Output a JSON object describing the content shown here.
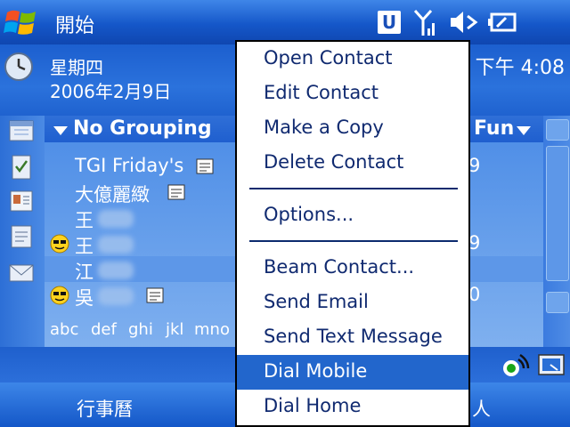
{
  "titlebar": {
    "title": "開始",
    "status_u": "U"
  },
  "today": {
    "day": "星期四",
    "date": "2006年2月9日",
    "time": "下午 4:08"
  },
  "list": {
    "grouping": "No Grouping",
    "right_header": "Fun",
    "rows": [
      {
        "name": "TGI Friday's",
        "right": "9"
      },
      {
        "name": "大億麗緻",
        "right": ""
      },
      {
        "name": "王",
        "right": ""
      },
      {
        "name": "王",
        "right": "9"
      },
      {
        "name": "江",
        "right": ""
      },
      {
        "name": "吳",
        "right": "0"
      }
    ],
    "alpha": [
      "abc",
      "def",
      "ghi",
      "jkl",
      "mno"
    ]
  },
  "menu": {
    "items": [
      "Open Contact",
      "Edit Contact",
      "Make a Copy",
      "Delete Contact",
      "Options...",
      "Beam Contact...",
      "Send Email",
      "Send Text Message",
      "Dial Mobile",
      "Dial Home"
    ]
  },
  "softkeys": {
    "left": "行事曆",
    "right": "人"
  },
  "colors": {
    "titlebar": "#1557c9",
    "menu_highlight": "#2266cc",
    "menu_text": "#102a70"
  }
}
